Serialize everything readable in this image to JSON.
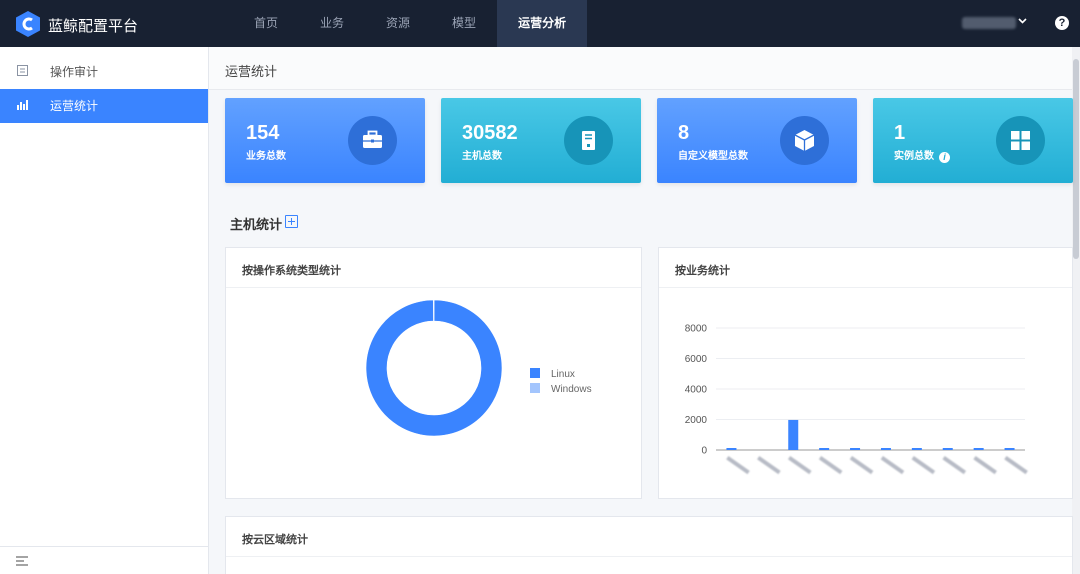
{
  "app": {
    "title": "蓝鲸配置平台"
  },
  "topnav": [
    {
      "label": "首页"
    },
    {
      "label": "业务"
    },
    {
      "label": "资源"
    },
    {
      "label": "模型"
    },
    {
      "label": "运营分析",
      "active": true
    }
  ],
  "help": {
    "label": "?"
  },
  "sidebar": {
    "items": [
      {
        "label": "操作审计",
        "icon": "audit-list-icon"
      },
      {
        "label": "运营统计",
        "icon": "bar-stats-icon",
        "active": true
      }
    ]
  },
  "page": {
    "title": "运营统计"
  },
  "stats": [
    {
      "value": "154",
      "label": "业务总数",
      "icon": "briefcase-icon"
    },
    {
      "value": "30582",
      "label": "主机总数",
      "icon": "server-icon"
    },
    {
      "value": "8",
      "label": "自定义模型总数",
      "icon": "cube-icon"
    },
    {
      "value": "1",
      "label": "实例总数",
      "icon": "grid-icon",
      "info": "i"
    }
  ],
  "section": {
    "title": "主机统计"
  },
  "panels": {
    "os": {
      "title": "按操作系统类型统计"
    },
    "biz": {
      "title": "按业务统计"
    },
    "cloud": {
      "title": "按云区域统计"
    }
  },
  "chart_data": [
    {
      "type": "pie",
      "labels": [
        "Linux",
        "Windows"
      ],
      "values": [
        30540,
        42
      ],
      "colors": [
        "#3a84ff",
        "#a3c5fd"
      ],
      "donut": true,
      "legend": "right"
    },
    {
      "type": "bar",
      "categories": [
        "",
        "",
        "",
        "",
        "",
        "",
        "",
        "",
        "",
        ""
      ],
      "values": [
        100,
        0,
        1970,
        120,
        110,
        100,
        100,
        90,
        90,
        120
      ],
      "ylim": [
        0,
        8000
      ],
      "yticks": [
        "0",
        "2000",
        "4000",
        "6000",
        "8000"
      ],
      "color": "#3a84ff",
      "grid": true
    }
  ]
}
